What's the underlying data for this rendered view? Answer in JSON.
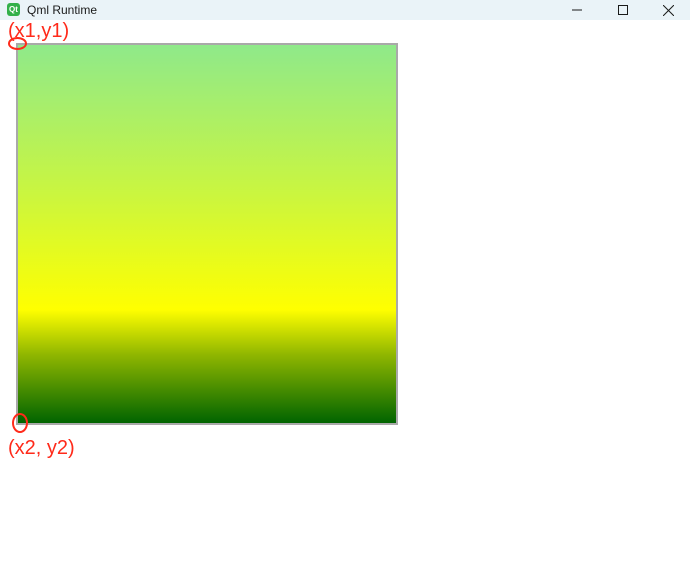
{
  "window": {
    "title": "Qml Runtime",
    "app_icon_text": "Qt",
    "controls": {
      "minimize_icon": "minimize-icon",
      "maximize_icon": "maximize-icon",
      "close_icon": "close-icon"
    }
  },
  "gradient": {
    "colors": [
      "#8fe98a",
      "#cbf63e",
      "#ffff00",
      "#8fb600",
      "#006400"
    ],
    "border_color": "#a9a9a9"
  },
  "annotations": {
    "start_label": "(x1,y1)",
    "end_label": "(x2, y2)",
    "color": "#ff2a1a"
  }
}
